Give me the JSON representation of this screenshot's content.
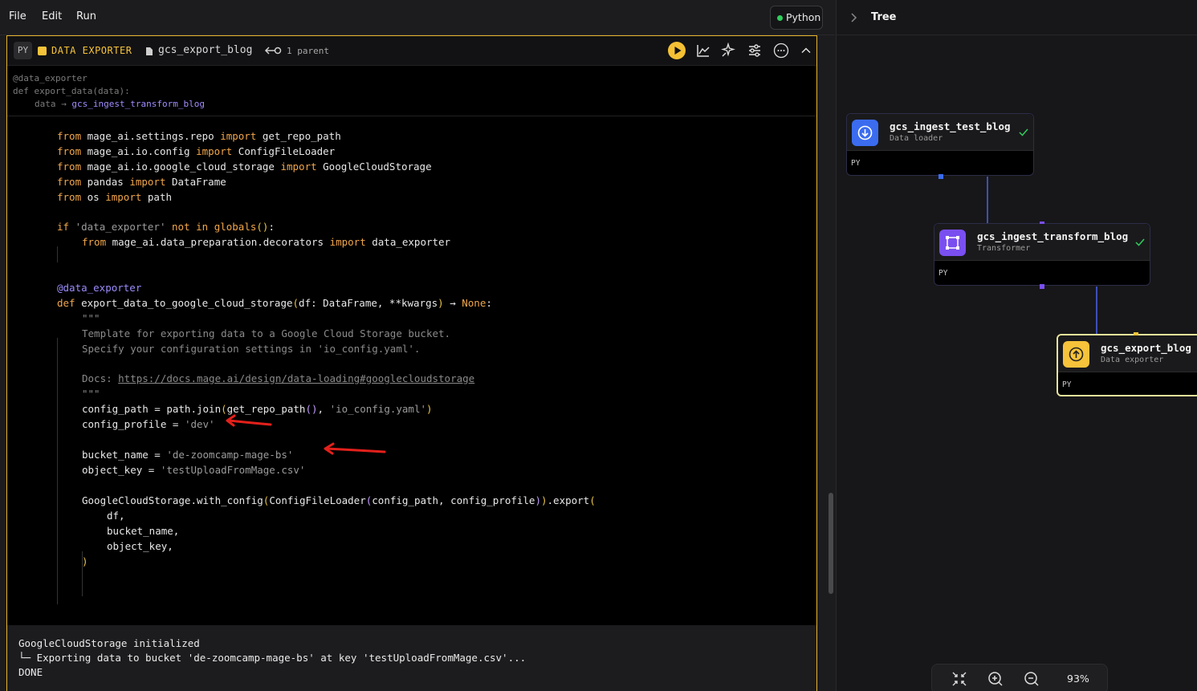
{
  "menu": {
    "file": "File",
    "edit": "Edit",
    "run": "Run"
  },
  "kernel": {
    "label": "Python",
    "status_color": "#2fce5c"
  },
  "block": {
    "lang_badge": "PY",
    "type_label": "DATA EXPORTER",
    "name": "gcs_export_blog",
    "parents_label": "1 parent",
    "accent_color": "#f6c33a",
    "actions": [
      "run-icon",
      "chart-icon",
      "sparkle-icon",
      "sliders-icon",
      "more-icon",
      "collapse-icon"
    ]
  },
  "signature": {
    "decorator": "@data_exporter",
    "def": "def export_data(data):",
    "arg": "data",
    "arrow": "→",
    "upstream": "gcs_ingest_transform_blog"
  },
  "code": {
    "l1": [
      "from",
      " mage_ai.settings.repo ",
      "import",
      " get_repo_path"
    ],
    "l2": [
      "from",
      " mage_ai.io.config ",
      "import",
      " ConfigFileLoader"
    ],
    "l3": [
      "from",
      " mage_ai.io.google_cloud_storage ",
      "import",
      " GoogleCloudStorage"
    ],
    "l4": [
      "from",
      " pandas ",
      "import",
      " DataFrame"
    ],
    "l5": [
      "from",
      " os ",
      "import",
      " path"
    ],
    "l7": [
      "if",
      " ",
      "'data_exporter'",
      " ",
      "not in",
      " ",
      "globals",
      "()",
      ":"
    ],
    "l8": [
      "from",
      " mage_ai.data_preparation.decorators ",
      "import",
      " data_exporter"
    ],
    "l11": "@data_exporter",
    "l12": [
      "def",
      " export_data_to_google_cloud_storage",
      "(",
      "df: DataFrame, **kwargs",
      ")",
      " → ",
      "None",
      ":"
    ],
    "l13": "\"\"\"",
    "l14": "Template for exporting data to a Google Cloud Storage bucket.",
    "l15": "Specify your configuration settings in 'io_config.yaml'.",
    "l17_prefix": "Docs: ",
    "l17_link": "https://docs.mage.ai/design/data-loading#googlecloudstorage",
    "l18": "\"\"\"",
    "l19": [
      "config_path = path.join",
      "(",
      "get_repo_path",
      "()",
      ", ",
      "'io_config.yaml'",
      ")"
    ],
    "l20": [
      "config_profile = ",
      "'dev'"
    ],
    "l22": [
      "bucket_name = ",
      "'de-zoomcamp-mage-bs'"
    ],
    "l23": [
      "object_key = ",
      "'testUploadFromMage.csv'"
    ],
    "l25": [
      "GoogleCloudStorage.with_config",
      "(",
      "ConfigFileLoader",
      "(",
      "config_path, config_profile",
      ")",
      ")",
      ".export",
      "("
    ],
    "l26": "df,",
    "l27": "bucket_name,",
    "l28": "object_key,",
    "l29": ")"
  },
  "output": {
    "line1": "GoogleCloudStorage initialized",
    "line2": "└─ Exporting data to bucket 'de-zoomcamp-mage-bs' at key 'testUploadFromMage.csv'...",
    "line3": "DONE"
  },
  "tree": {
    "title": "Tree",
    "nodes": [
      {
        "name": "gcs_ingest_test_blog",
        "type": "Data loader",
        "lang": "PY",
        "color": "#3b6cf0",
        "icon": "download-icon",
        "status": "check-icon"
      },
      {
        "name": "gcs_ingest_transform_blog",
        "type": "Transformer",
        "lang": "PY",
        "color": "#7a4ff0",
        "icon": "transform-icon",
        "status": "check-icon"
      },
      {
        "name": "gcs_export_blog",
        "type": "Data exporter",
        "lang": "PY",
        "color": "#f6c33a",
        "icon": "upload-icon"
      }
    ],
    "zoom": "93%"
  }
}
